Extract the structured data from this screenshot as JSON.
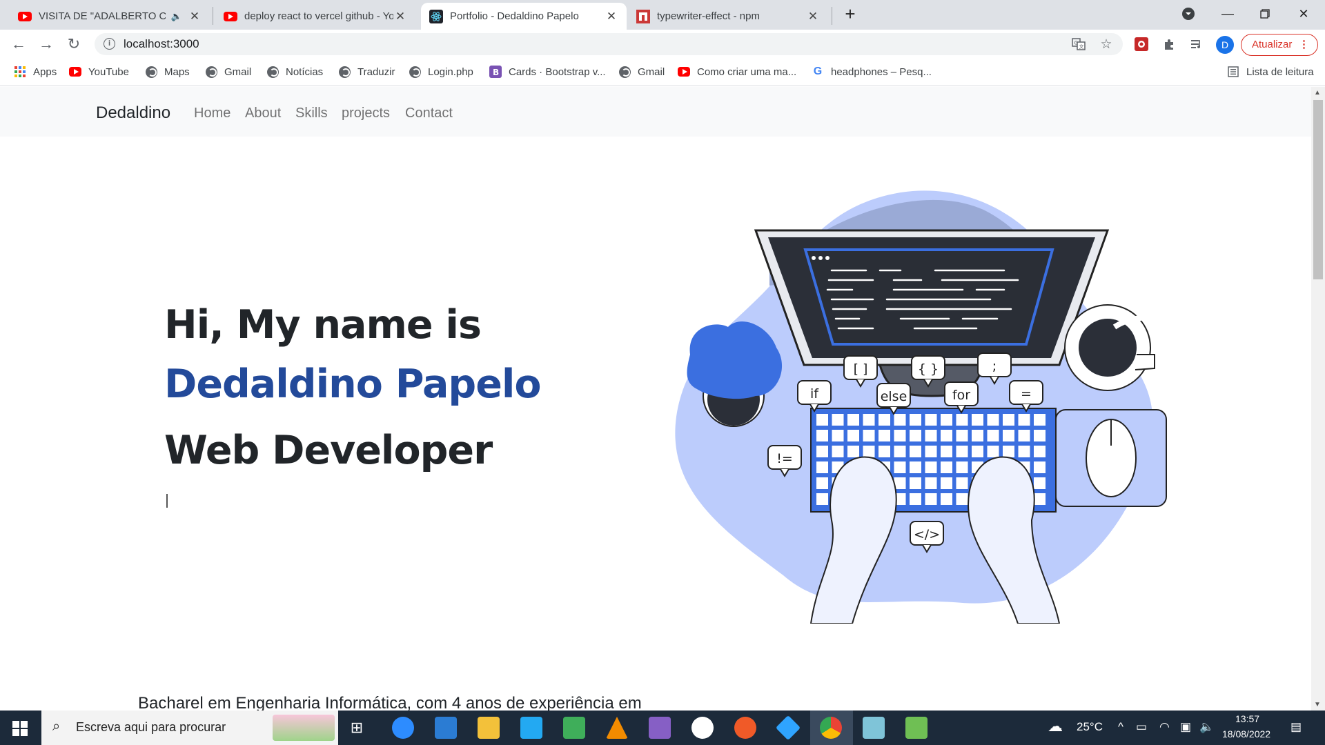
{
  "browser": {
    "tabs": [
      {
        "title": "VISITA DE \"ADALBERTO COST",
        "icon": "youtube-icon",
        "audio": true
      },
      {
        "title": "deploy react to vercel github - Yo",
        "icon": "youtube-icon"
      },
      {
        "title": "Portfolio - Dedaldino Papelo",
        "icon": "react-icon",
        "active": true
      },
      {
        "title": "typewriter-effect - npm",
        "icon": "npm-icon"
      }
    ],
    "url": "localhost:3000",
    "update_label": "Atualizar",
    "profile_initial": "D",
    "bookmarks": [
      "Apps",
      "YouTube",
      "Maps",
      "Gmail",
      "Notícias",
      "Traduzir",
      "Login.php",
      "Cards · Bootstrap v...",
      "Gmail",
      "Como criar uma ma...",
      "headphones – Pesq..."
    ],
    "reading_list": "Lista de leitura"
  },
  "site": {
    "brand": "Dedaldino",
    "nav": [
      "Home",
      "About",
      "Skills",
      "projects",
      "Contact"
    ],
    "hero": {
      "line1": "Hi, My name is",
      "name": "Dedaldino Papelo",
      "role": "Web Developer",
      "name_color": "#234a9a"
    },
    "bio": "Bacharel em Engenharia Informática, com 4 anos de experiência em",
    "illustration": {
      "labels": [
        "if",
        "[ ]",
        "else",
        "{ }",
        "for",
        ";",
        "=",
        "!=",
        "</>"
      ]
    }
  },
  "taskbar": {
    "search_placeholder": "Escreva aqui para procurar",
    "weather": "25°C",
    "time": "13:57",
    "date": "18/08/2022"
  },
  "colors": {
    "accent": "#234a9a",
    "chrome_tab_bg": "#dee1e6",
    "taskbar": "#1c2a3a",
    "update_red": "#d93025",
    "illustration_blue": "#bcccfc",
    "keyboard_blue": "#3b6fe0"
  }
}
